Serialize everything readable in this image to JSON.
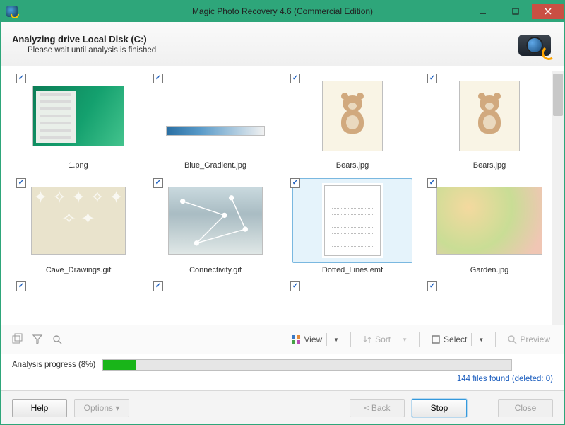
{
  "window": {
    "title": "Magic Photo Recovery 4.6 (Commercial Edition)"
  },
  "header": {
    "title": "Analyzing drive Local Disk (C:)",
    "subtitle": "Please wait until analysis is finished"
  },
  "grid": {
    "items": [
      {
        "label": "1.png",
        "checked": true,
        "thumb": "th-1png",
        "selected": false
      },
      {
        "label": "Blue_Gradient.jpg",
        "checked": true,
        "thumb": "th-bluegrad",
        "selected": false
      },
      {
        "label": "Bears.jpg",
        "checked": true,
        "thumb": "th-bears",
        "selected": false
      },
      {
        "label": "Bears.jpg",
        "checked": true,
        "thumb": "th-bears",
        "selected": false
      },
      {
        "label": "Cave_Drawings.gif",
        "checked": true,
        "thumb": "th-cave",
        "selected": false
      },
      {
        "label": "Connectivity.gif",
        "checked": true,
        "thumb": "th-conn",
        "selected": false
      },
      {
        "label": "Dotted_Lines.emf",
        "checked": true,
        "thumb": "th-dotted",
        "selected": true
      },
      {
        "label": "Garden.jpg",
        "checked": true,
        "thumb": "th-garden",
        "selected": false
      }
    ]
  },
  "toolbar": {
    "view": "View",
    "sort": "Sort",
    "select": "Select",
    "preview": "Preview"
  },
  "progress": {
    "label": "Analysis progress (8%)",
    "percent": 8
  },
  "status": {
    "text": "144 files found (deleted: 0)"
  },
  "buttons": {
    "help": "Help",
    "options": "Options ▾",
    "back": "< Back",
    "stop": "Stop",
    "close": "Close"
  }
}
